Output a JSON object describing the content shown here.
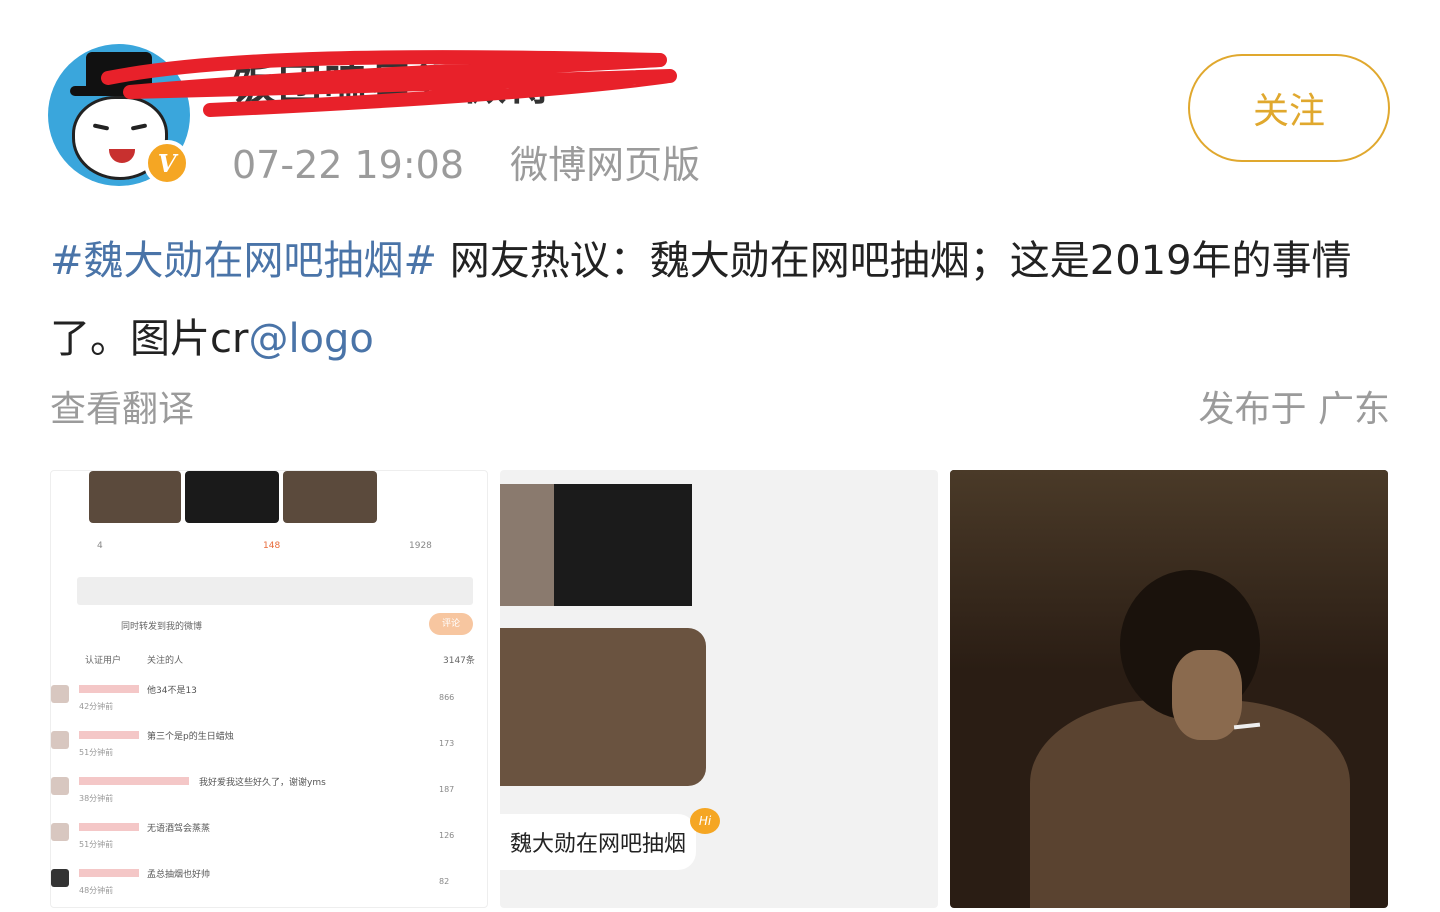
{
  "post": {
    "username": "饭团嗑星记微博",
    "timestamp": "07-22 19:08",
    "source": "微博网页版",
    "follow_label": "关注",
    "verified_badge": "V",
    "content": {
      "hashtag": "#魏大勋在网吧抽烟#",
      "text": " 网友热议：魏大勋在网吧抽烟；这是2019年的事情了。图片cr",
      "mention": "@logo"
    },
    "translate_label": "查看翻译",
    "location": "发布于 广东"
  },
  "colors": {
    "link": "#4a74a8",
    "follow": "#e0a82e",
    "meta": "#9b9b9b",
    "badge": "#f5a623"
  },
  "images": {
    "thumb1": {
      "stats": [
        "4",
        "148",
        "1928"
      ],
      "input_hint": "同时转发到我的微博",
      "submit": "评论",
      "tabs": [
        "认证用户",
        "关注的人"
      ],
      "count": "3147条",
      "comments": [
        {
          "text": "他34不是13",
          "time": "42分钟前",
          "likes": "866"
        },
        {
          "text": "第三个是p的生日蜡烛",
          "time": "51分钟前",
          "likes": "173"
        },
        {
          "text": "我好爱我这些好久了，谢谢yms",
          "time": "38分钟前",
          "likes": "187"
        },
        {
          "text": "无语酒驾会蒸蒸",
          "time": "51分钟前",
          "likes": "126"
        },
        {
          "text": "孟总抽烟也好帅",
          "time": "48分钟前",
          "likes": "82"
        }
      ]
    },
    "thumb2": {
      "caption": "魏大勋在网吧抽烟",
      "badge": "Hi"
    }
  }
}
